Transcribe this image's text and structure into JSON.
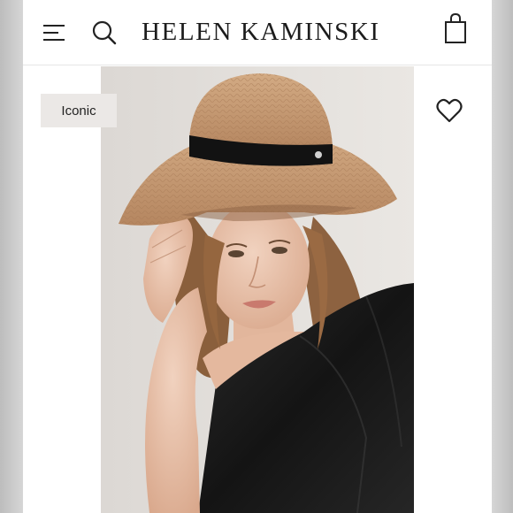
{
  "header": {
    "brand": "HELEN KAMINSKI",
    "icons": [
      "menu-icon",
      "search-icon",
      "shopping-bag-icon"
    ]
  },
  "product": {
    "badge": "Iconic",
    "image_alt": "woman-wearing-raffia-hat-with-black-ribbon",
    "wishlist_icon": "heart-icon"
  },
  "colors": {
    "background": "#ffffff",
    "text": "#1c1c1c",
    "badge_bg": "#ebe8e6",
    "hat_raffia": "#c49a72",
    "ribbon": "#121212",
    "dress": "#161616"
  }
}
